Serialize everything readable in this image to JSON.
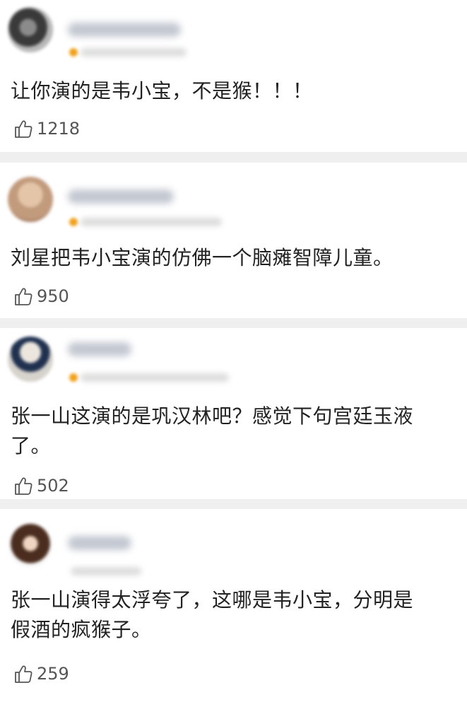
{
  "comments": [
    {
      "text": "让你演的是韦小宝，不是猴！！！",
      "likes": "1218",
      "icons": {
        "avatar": "avatar-blurred",
        "like": "thumbs-up-icon"
      }
    },
    {
      "text": "刘星把韦小宝演的仿佛一个脑瘫智障儿童。",
      "likes": "950",
      "icons": {
        "avatar": "avatar-blurred",
        "like": "thumbs-up-icon"
      }
    },
    {
      "text": "张一山这演的是巩汉林吧？感觉下句宫廷玉液\n了。",
      "likes": "502",
      "icons": {
        "avatar": "avatar-blurred",
        "like": "thumbs-up-icon"
      }
    },
    {
      "text": "张一山演得太浮夸了，这哪是韦小宝，分明是\n假酒的疯猴子。",
      "likes": "259",
      "icons": {
        "avatar": "avatar-blurred",
        "like": "thumbs-up-icon"
      }
    }
  ],
  "colors": {
    "background": "#efefef",
    "card": "#ffffff",
    "text": "#222222",
    "like_text": "#555555",
    "level_badge": "#f0a11a"
  }
}
